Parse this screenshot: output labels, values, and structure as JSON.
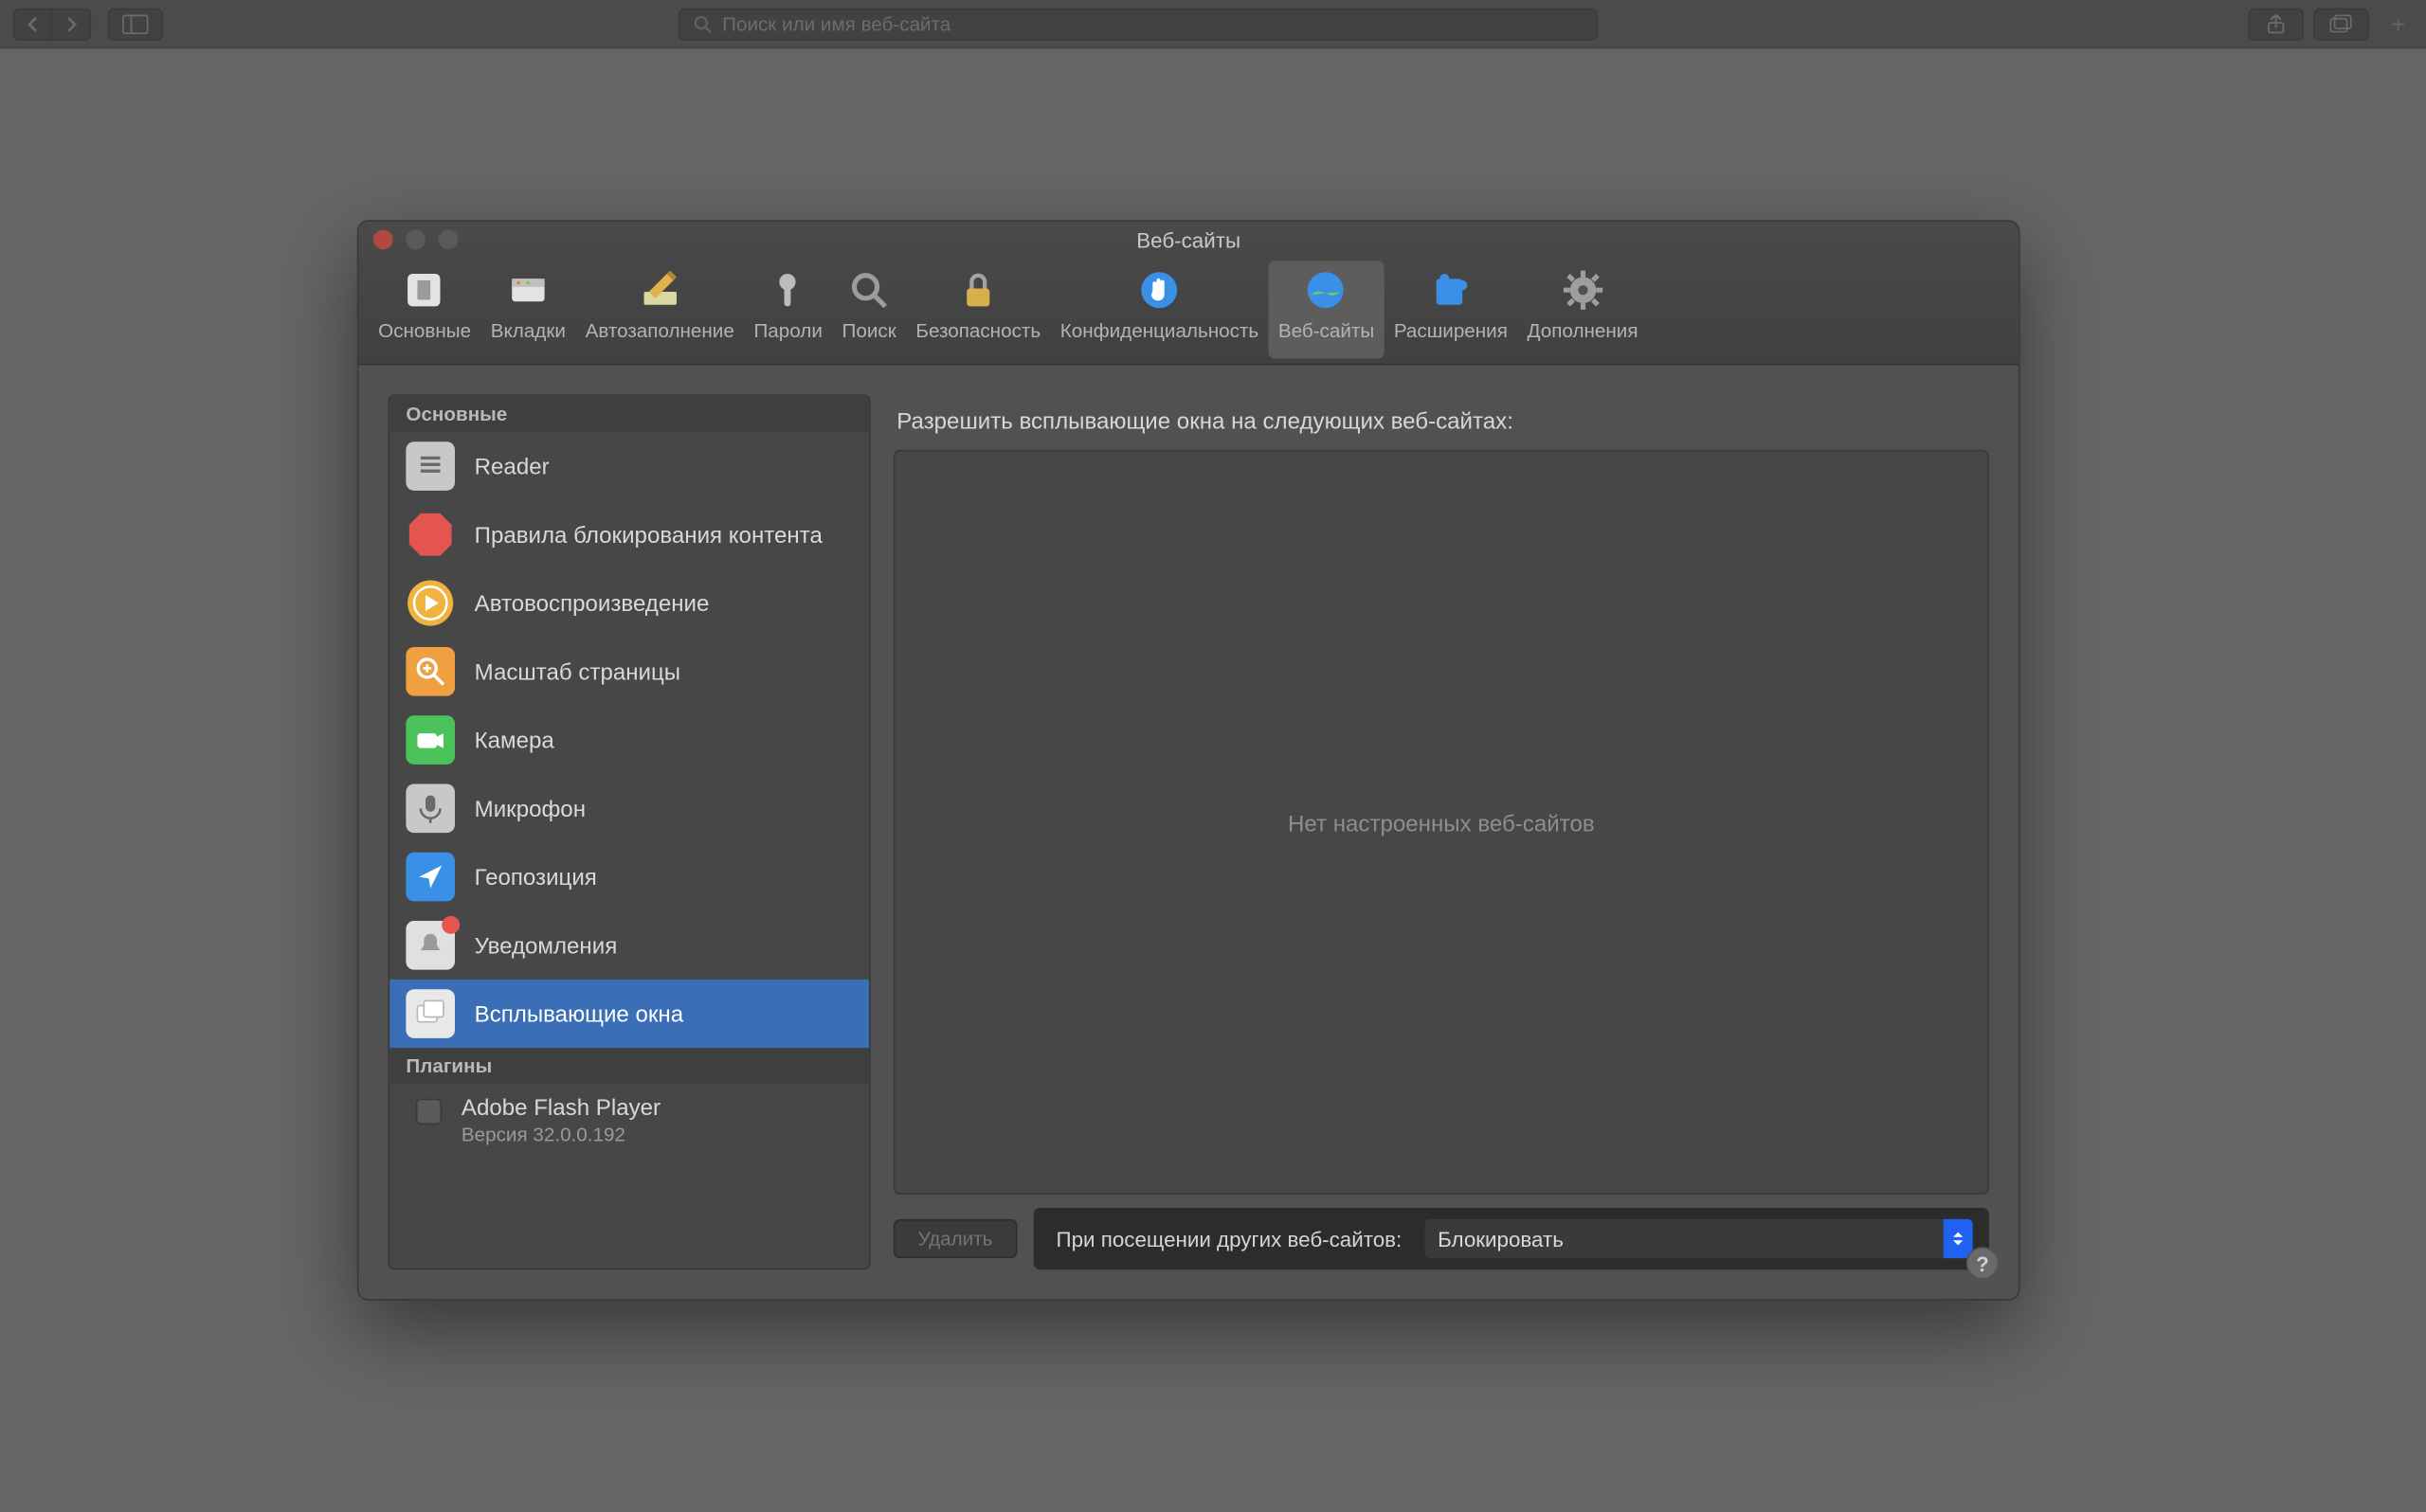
{
  "browser": {
    "search_placeholder": "Поиск или имя веб-сайта"
  },
  "prefs": {
    "title": "Веб-сайты",
    "tabs": [
      {
        "id": "general",
        "label": "Основные"
      },
      {
        "id": "tabs",
        "label": "Вкладки"
      },
      {
        "id": "autofill",
        "label": "Автозаполнение"
      },
      {
        "id": "passwords",
        "label": "Пароли"
      },
      {
        "id": "search",
        "label": "Поиск"
      },
      {
        "id": "security",
        "label": "Безопасность"
      },
      {
        "id": "privacy",
        "label": "Конфиденциальность"
      },
      {
        "id": "websites",
        "label": "Веб-сайты",
        "selected": true
      },
      {
        "id": "extensions",
        "label": "Расширения"
      },
      {
        "id": "advanced",
        "label": "Дополнения"
      }
    ],
    "sidebar": {
      "section_main": "Основные",
      "items": [
        {
          "id": "reader",
          "label": "Reader",
          "icon": "reader",
          "bg": "#c8c8c8"
        },
        {
          "id": "contentblock",
          "label": "Правила блокирования контента",
          "icon": "stop",
          "bg": "#e4554f"
        },
        {
          "id": "autoplay",
          "label": "Автовоспроизведение",
          "icon": "play",
          "bg": "#f1b23e"
        },
        {
          "id": "zoom",
          "label": "Масштаб страницы",
          "icon": "zoom",
          "bg": "#f0a040"
        },
        {
          "id": "camera",
          "label": "Камера",
          "icon": "camera",
          "bg": "#4cc35a"
        },
        {
          "id": "mic",
          "label": "Микрофон",
          "icon": "mic",
          "bg": "#c8c8c8"
        },
        {
          "id": "location",
          "label": "Геопозиция",
          "icon": "location",
          "bg": "#3a8fe6"
        },
        {
          "id": "notif",
          "label": "Уведомления",
          "icon": "bell",
          "bg": "#e0e0e0",
          "badge": true
        },
        {
          "id": "popups",
          "label": "Всплывающие окна",
          "icon": "windows",
          "bg": "#e8e8e8",
          "selected": true
        }
      ],
      "section_plugins": "Плагины",
      "plugin": {
        "name": "Adobe Flash Player",
        "version": "Версия 32.0.0.192"
      }
    },
    "main": {
      "heading": "Разрешить всплывающие окна на следующих веб-сайтах:",
      "empty": "Нет настроенных веб-сайтов",
      "delete": "Удалить",
      "other_label": "При посещении других веб-сайтов:",
      "select_value": "Блокировать"
    }
  }
}
